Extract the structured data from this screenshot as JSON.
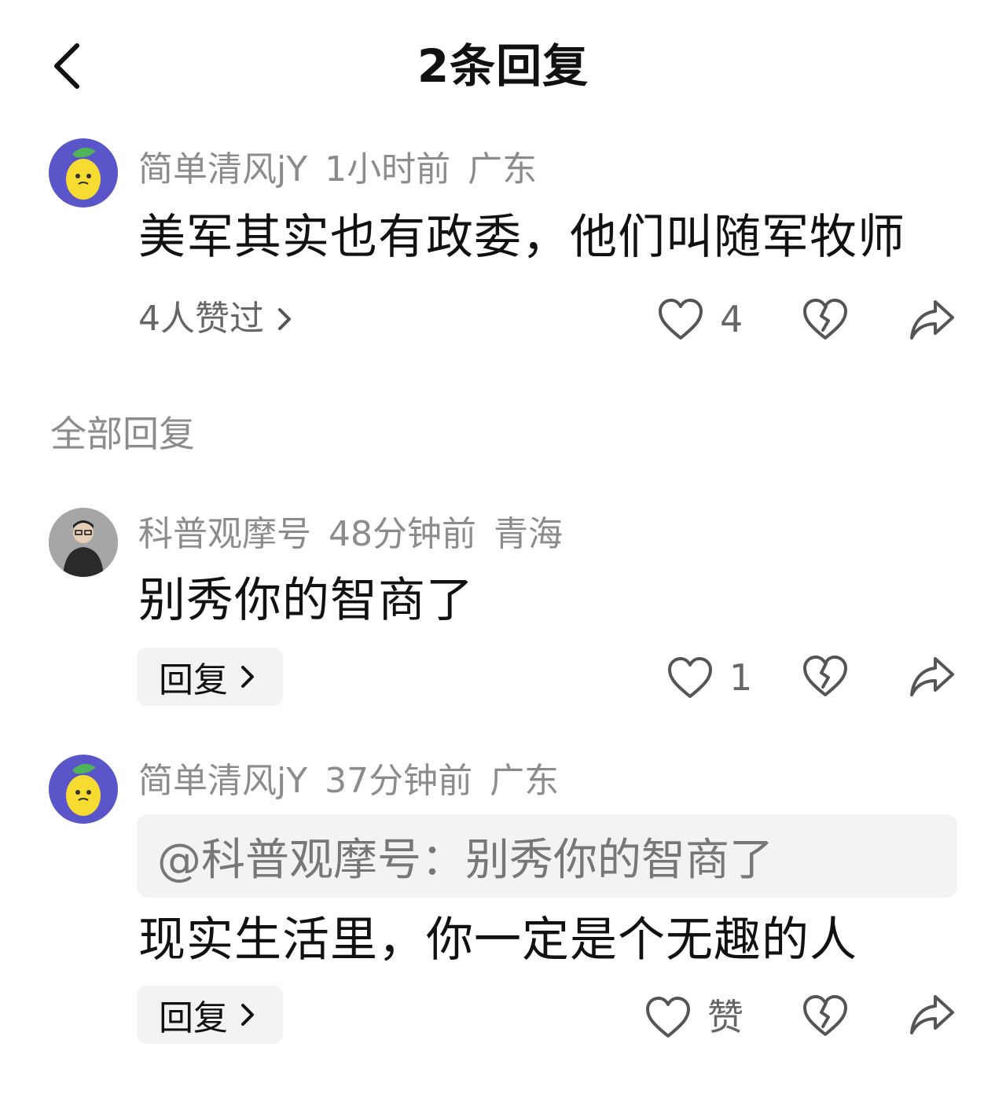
{
  "header": {
    "title": "2条回复"
  },
  "main_comment": {
    "username": "简单清风jY",
    "time": "1小时前",
    "location": "广东",
    "text": "美军其实也有政委，他们叫随军牧师",
    "likes_summary": "4人赞过",
    "like_count": "4"
  },
  "section": {
    "label": "全部回复"
  },
  "replies": [
    {
      "username": "科普观摩号",
      "time": "48分钟前",
      "location": "青海",
      "text": "别秀你的智商了",
      "reply_label": "回复",
      "like_count": "1"
    },
    {
      "username": "简单清风jY",
      "time": "37分钟前",
      "location": "广东",
      "quote": "@科普观摩号：别秀你的智商了",
      "text": "现实生活里，你一定是个无趣的人",
      "reply_label": "回复",
      "like_label": "赞"
    }
  ],
  "icons": {
    "back": "chevron-left-icon",
    "like": "heart-outline-icon",
    "dislike": "broken-heart-icon",
    "share": "share-arrow-icon",
    "chevron": "chevron-right-icon"
  },
  "colors": {
    "avatar_lemon_bg": "#5a55c9",
    "meta_gray": "#8c8c8c",
    "reply_bg": "#f3f3f3"
  }
}
